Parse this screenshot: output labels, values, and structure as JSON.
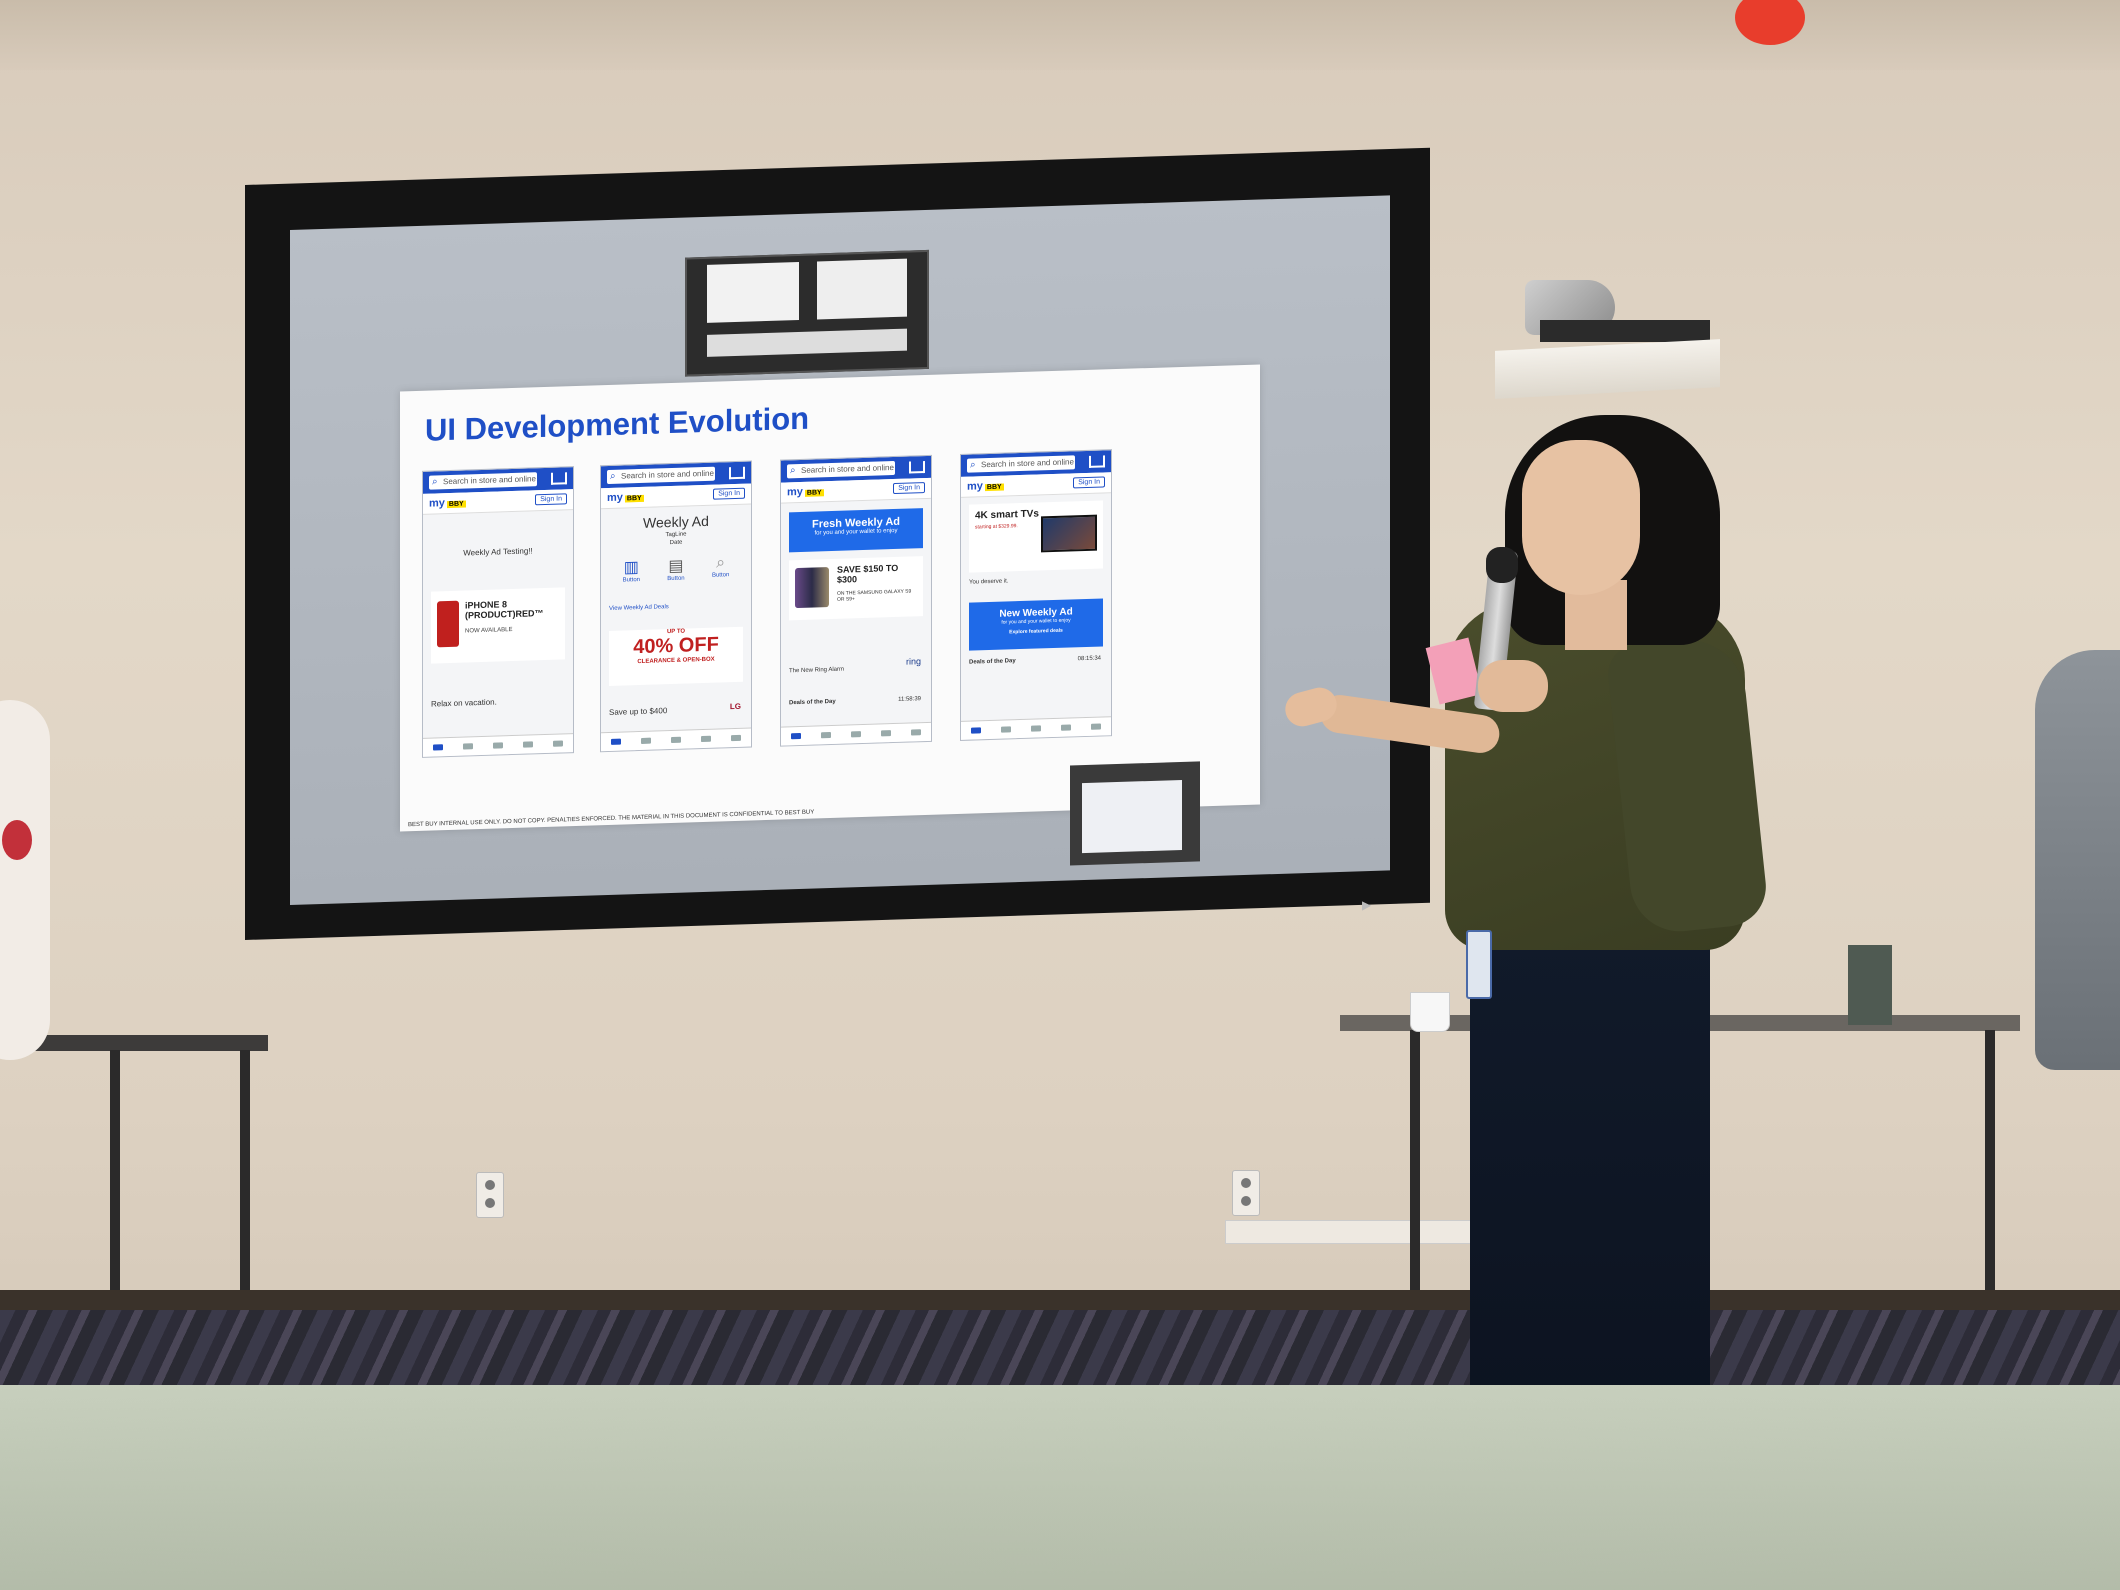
{
  "slide": {
    "title": "UI Development Evolution",
    "footer": "BEST BUY  INTERNAL USE ONLY. DO NOT COPY. PENALTIES ENFORCED. THE MATERIAL IN THIS DOCUMENT IS CONFIDENTIAL TO BEST BUY",
    "phones": [
      {
        "search": "Search in store and online",
        "logo": "my",
        "signin": "Sign In",
        "body_text": "Weekly Ad Testing!!",
        "promo_title": "iPHONE 8 (PRODUCT)RED™",
        "promo_sub": "NOW AVAILABLE",
        "deal_text": "Relax on vacation."
      },
      {
        "search": "Search in store and online",
        "logo": "my",
        "signin": "Sign In",
        "heading": "Weekly Ad",
        "tagline": "TagLine",
        "date": "Date",
        "buttons": [
          "Button",
          "Button",
          "Button"
        ],
        "link": "View Weekly Ad Deals",
        "percent": "40% OFF",
        "promo_pre": "UP TO",
        "promo_sub": "CLEARANCE & OPEN-BOX",
        "deal_text": "Save up to $400",
        "brand": "LG"
      },
      {
        "search": "Search in store and online",
        "logo": "my",
        "signin": "Sign In",
        "banner": "Fresh Weekly Ad",
        "banner_sub": "for you and your wallet to enjoy",
        "save_title": "SAVE $150 TO $300",
        "save_sub": "ON THE SAMSUNG GALAXY S9 OR S9+",
        "ring_text": "The New Ring Alarm",
        "ring_brand": "ring",
        "deals_label": "Deals of the Day",
        "timer": "11:58:39"
      },
      {
        "search": "Search in store and online",
        "logo": "my",
        "signin": "Sign In",
        "tv_title": "4K smart TVs",
        "tv_sub": "starting at $329.99.",
        "deserve": "You deserve it.",
        "banner": "New Weekly Ad",
        "banner_sub": "for you and your wallet to enjoy",
        "explore": "Explore featured deals",
        "deals_label": "Deals of the Day",
        "timer": "08:15:34"
      }
    ]
  },
  "colors": {
    "title_blue": "#1f4fc6",
    "banner_blue": "#1f6ae8",
    "screen_frame": "#141414",
    "shirt": "#43472a"
  }
}
